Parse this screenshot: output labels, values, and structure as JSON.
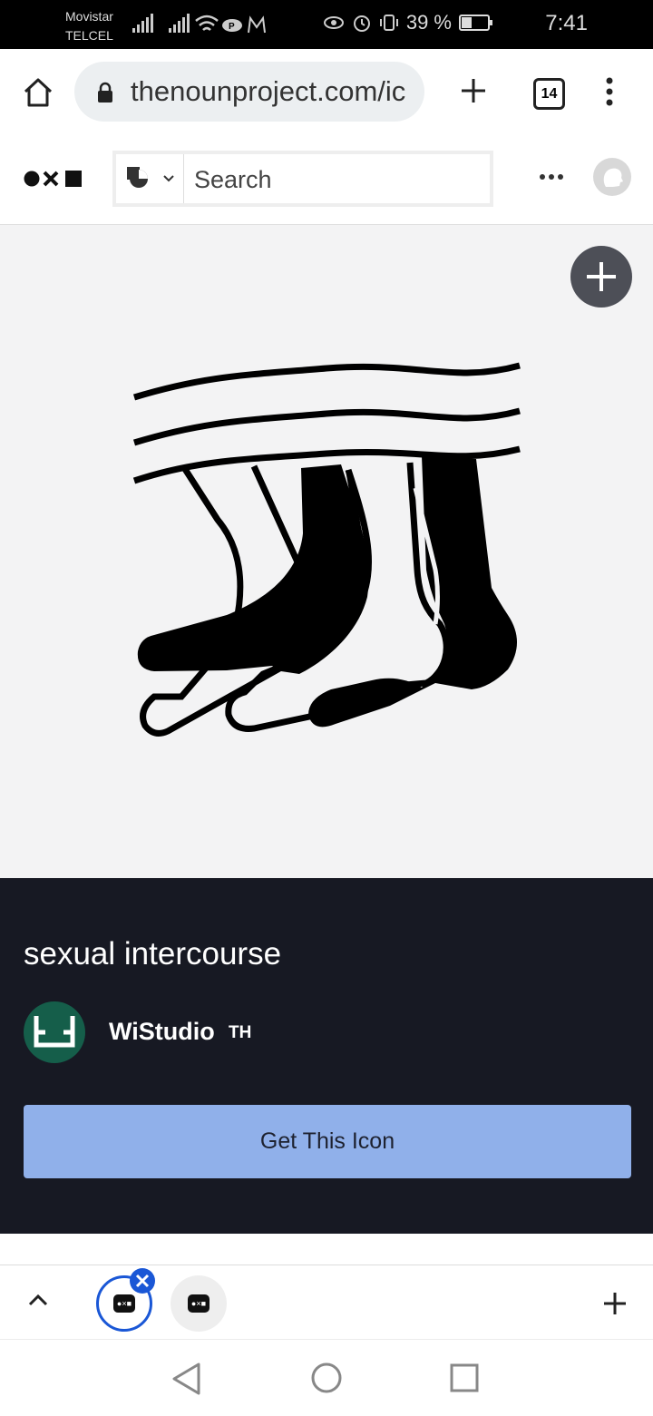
{
  "status_bar": {
    "carrier_1": "Movistar",
    "carrier_2": "TELCEL",
    "battery_text": "39 %",
    "battery_level": 0.39,
    "time": "7:41"
  },
  "browser": {
    "url": "thenounproject.com/ic",
    "tab_count": "14"
  },
  "site": {
    "search_placeholder": "Search"
  },
  "icon": {
    "title": "sexual intercourse",
    "creator_name": "WiStudio",
    "creator_country": "TH",
    "cta": "Get This Icon"
  },
  "colors": {
    "info_bg": "#171923",
    "cta_bg": "#90b0ea",
    "creator_avatar": "#155e4a",
    "active_tab_ring": "#1a57d6"
  }
}
